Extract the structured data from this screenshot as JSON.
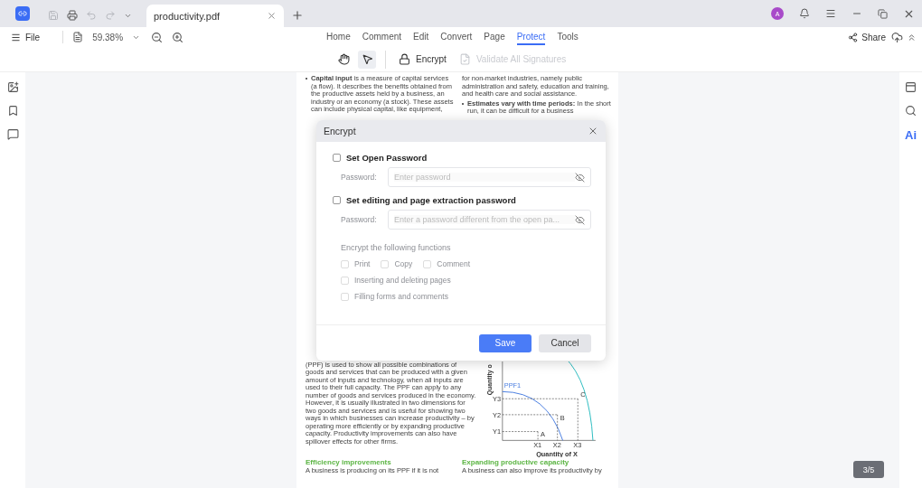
{
  "title_bar": {
    "quick_tools": [
      {
        "kind": "save",
        "disabled": true
      },
      {
        "kind": "print",
        "disabled": false
      },
      {
        "kind": "undo",
        "disabled": true
      },
      {
        "kind": "redo",
        "disabled": true
      }
    ],
    "tab": {
      "label": "productivity.pdf"
    },
    "avatar": "A"
  },
  "menu_bar": {
    "file": "File",
    "zoom": "59.38%",
    "tabs": [
      {
        "label": "Home",
        "selected": false
      },
      {
        "label": "Comment",
        "selected": false
      },
      {
        "label": "Edit",
        "selected": false
      },
      {
        "label": "Convert",
        "selected": false
      },
      {
        "label": "Page",
        "selected": false
      },
      {
        "label": "Protect",
        "selected": true
      },
      {
        "label": "Tools",
        "selected": false
      }
    ],
    "share": "Share"
  },
  "ribbon": {
    "tools": [
      {
        "kind": "hand",
        "selected": false
      },
      {
        "kind": "pointer",
        "selected": true
      }
    ],
    "actions": [
      {
        "kind": "lock",
        "label": "Encrypt",
        "disabled": false
      },
      {
        "kind": "signature",
        "label": "Validate All Signatures",
        "disabled": true
      }
    ]
  },
  "right_sidebar": {
    "ai_label": "Ai"
  },
  "document": {
    "top_left": [
      "**Capital input** is a measure of capital services (a flow). It describes the benefits obtained from the productive assets held by a business, an industry or an economy (a stock). These assets can include physical capital, like equipment,"
    ],
    "top_right": [
      {
        "kind": "text",
        "text": "for non-market industries, namely public administration and safety, education and training, and health care and social assistance."
      },
      {
        "kind": "bullet",
        "text": "**Estimates vary with time periods:** In the short run, it can be difficult for a business"
      }
    ],
    "bottom_left": "(PPF) is used to show all possible combinations of goods and services that can be produced with a given amount of inputs and technology, when all inputs are used to their full capacity. The PPF can apply to any number of goods and services produced in the economy. However, it is usually illustrated in two dimensions for two goods and services and is useful for showing two ways in which businesses can increase productivity – by operating more efficiently or by expanding productive capacity. Productivity improvements can also have spillover effects for other firms.",
    "figure": {
      "y_axis": "Quantity o",
      "x_axis": "Quantity of X",
      "curve": "PPF1",
      "x_ticks": [
        "X1",
        "X2",
        "X3"
      ],
      "y_ticks": [
        "Y3",
        "Y2",
        "Y1"
      ],
      "points": [
        "A",
        "B",
        "C"
      ]
    },
    "sections": [
      {
        "heading": "Efficiency improvements",
        "text": "A business is producing on its PPF if it is not"
      },
      {
        "heading": "Expanding productive capacity",
        "text": "A business can also improve its productivity by"
      }
    ]
  },
  "dialog": {
    "title": "Encrypt",
    "passwords": [
      {
        "label": "Set Open Password",
        "checked": false,
        "field_label": "Password:",
        "placeholder": "Enter password"
      },
      {
        "label": "Set editing and page extraction password",
        "checked": false,
        "field_label": "Password:",
        "placeholder": "Enter a password different from the open pa..."
      }
    ],
    "functions_title": "Encrypt the following functions",
    "functions_disabled": true,
    "functions": [
      [
        {
          "label": "Print",
          "checked": false
        },
        {
          "label": "Copy",
          "checked": false
        },
        {
          "label": "Comment",
          "checked": false
        }
      ],
      [
        {
          "label": "Inserting and deleting pages",
          "checked": false
        }
      ],
      [
        {
          "label": "Filling forms and comments",
          "checked": false
        }
      ]
    ],
    "save": "Save",
    "cancel": "Cancel"
  },
  "page_indicator": "3/5"
}
